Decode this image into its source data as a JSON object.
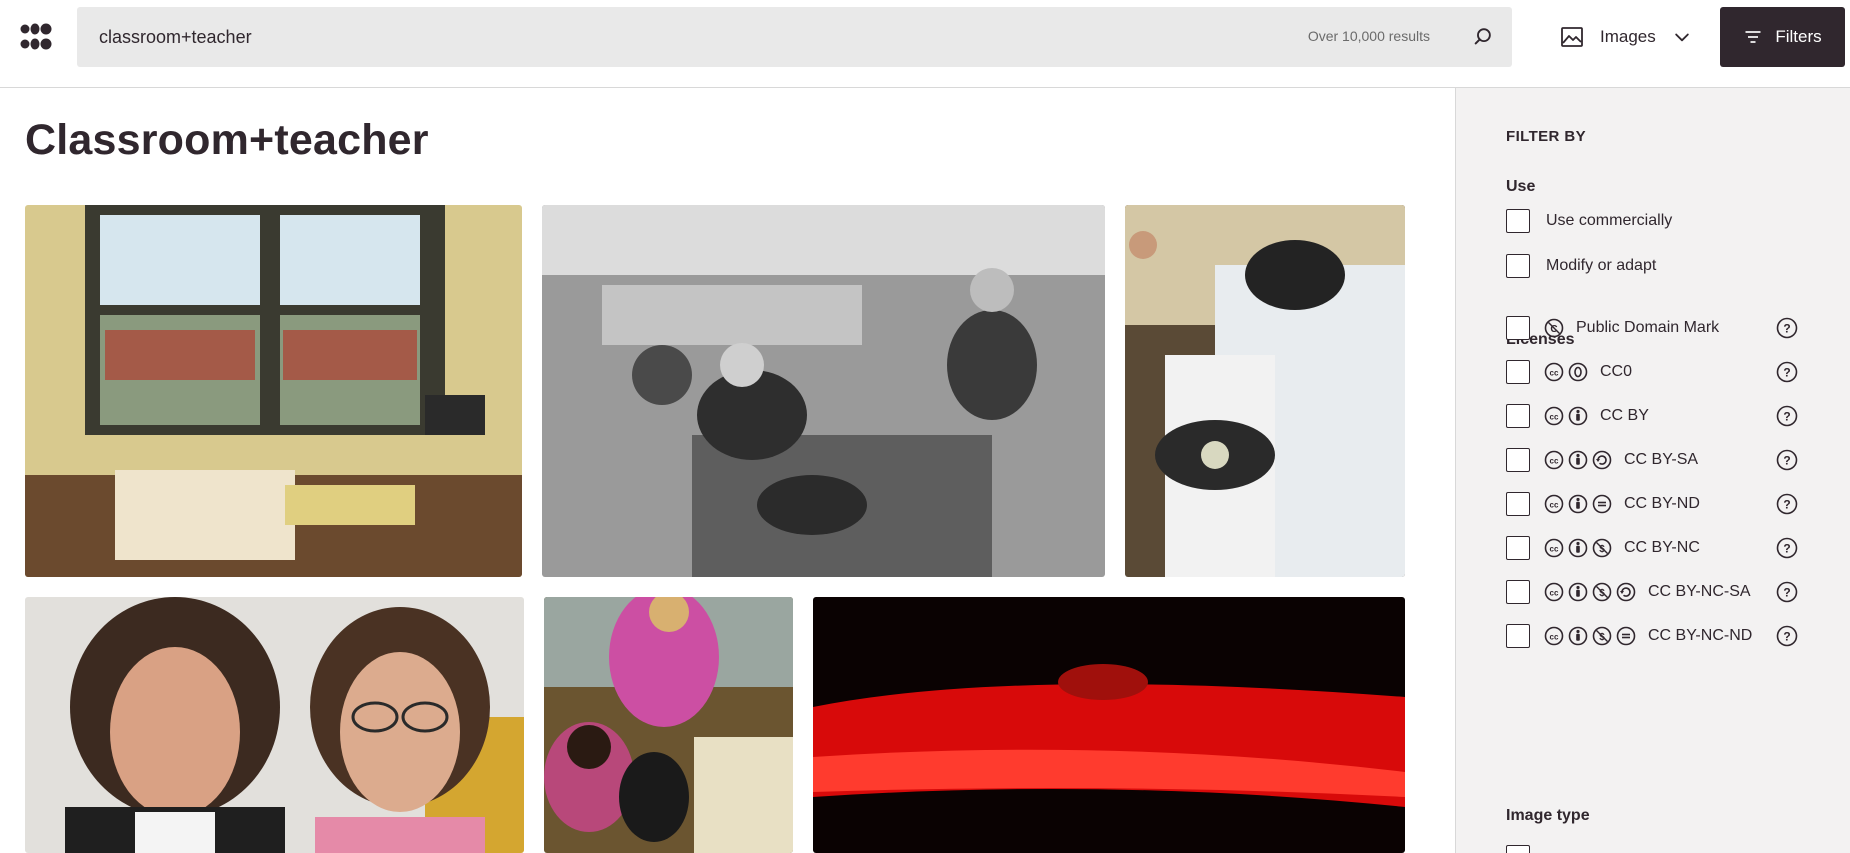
{
  "header": {
    "search_value": "classroom+teacher",
    "results_count": "Over 10,000 results",
    "content_type": "Images",
    "filters_label": "Filters"
  },
  "main": {
    "title": "Classroom+teacher"
  },
  "sidebar": {
    "heading": "FILTER BY",
    "use_title": "Use",
    "use_options": [
      "Use commercially",
      "Modify or adapt"
    ],
    "licenses_title": "Licenses",
    "licenses": [
      {
        "label": "Public Domain Mark",
        "icons": [
          "pdm"
        ]
      },
      {
        "label": "CC0",
        "icons": [
          "cc",
          "zero"
        ]
      },
      {
        "label": "CC BY",
        "icons": [
          "cc",
          "by"
        ]
      },
      {
        "label": "CC BY-SA",
        "icons": [
          "cc",
          "by",
          "sa"
        ]
      },
      {
        "label": "CC BY-ND",
        "icons": [
          "cc",
          "by",
          "nd"
        ]
      },
      {
        "label": "CC BY-NC",
        "icons": [
          "cc",
          "by",
          "nc"
        ]
      },
      {
        "label": "CC BY-NC-SA",
        "icons": [
          "cc",
          "by",
          "nc",
          "sa"
        ]
      },
      {
        "label": "CC BY-NC-ND",
        "icons": [
          "cc",
          "by",
          "nc",
          "nd"
        ]
      }
    ],
    "image_type_title": "Image type"
  },
  "colors": {
    "ink": "#30272e",
    "search_bg": "#e9e9e9",
    "sidebar_bg": "#f3f2f2"
  }
}
